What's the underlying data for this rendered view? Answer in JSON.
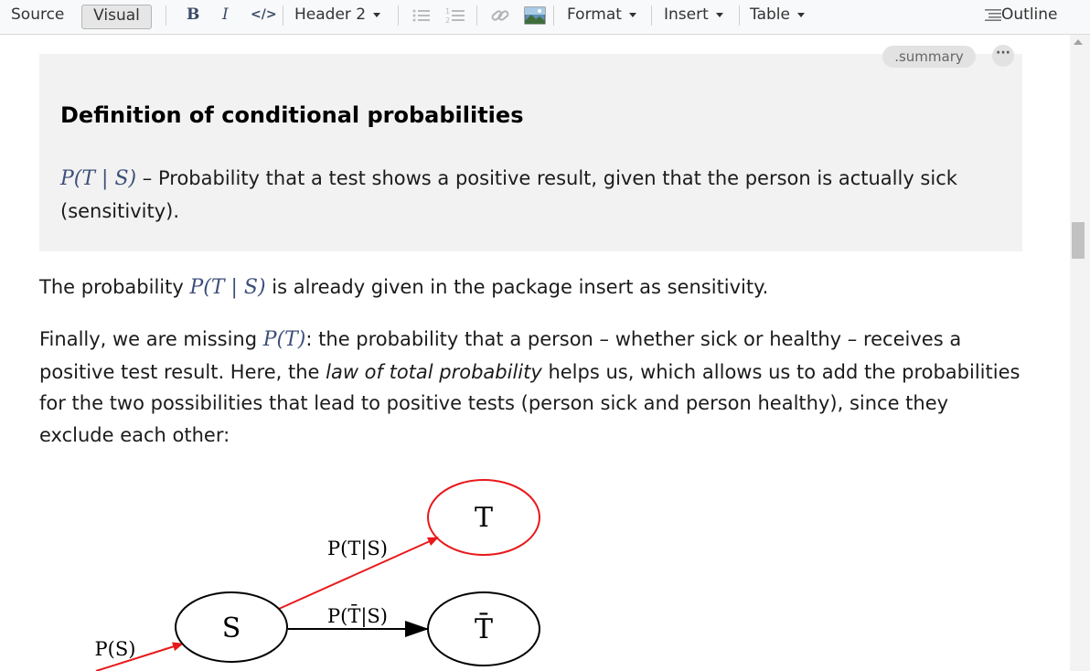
{
  "toolbar": {
    "source": "Source",
    "visual": "Visual",
    "bold": "B",
    "italic": "I",
    "code": "</>",
    "heading": "Header 2",
    "format": "Format",
    "insert": "Insert",
    "table": "Table",
    "outline": "Outline"
  },
  "summary": {
    "tag": ".summary",
    "more": "···",
    "title": "Definition of conditional probabilities",
    "def_math": "P(T | S)",
    "def_text": " – Probability that a test shows a positive result, given that the person is actually sick (sensitivity)."
  },
  "content": {
    "p1_pre": "The probability ",
    "p1_math": "P(T | S)",
    "p1_post": " is already given in the package insert as sensitivity.",
    "p2_pre": "Finally, we are missing ",
    "p2_math": "P(T)",
    "p2_mid": ": the probability that a person – whether sick or healthy – receives a positive test result. Here, the ",
    "p2_emph": "law of total probability",
    "p2_post": " helps us, which allows us to add the probabilities for the two possibilities that lead to positive tests (person sick and person healthy), since they exclude each other:"
  },
  "diagram": {
    "node_s": "S",
    "node_t": "T",
    "node_tbar": "T̄",
    "edge_ps": "P(S)",
    "edge_t_given_s": "P(T|S)",
    "edge_tbar_given_s": "P(T̄|S)",
    "colors": {
      "highlight": "#e8191b",
      "default": "#000000"
    }
  }
}
